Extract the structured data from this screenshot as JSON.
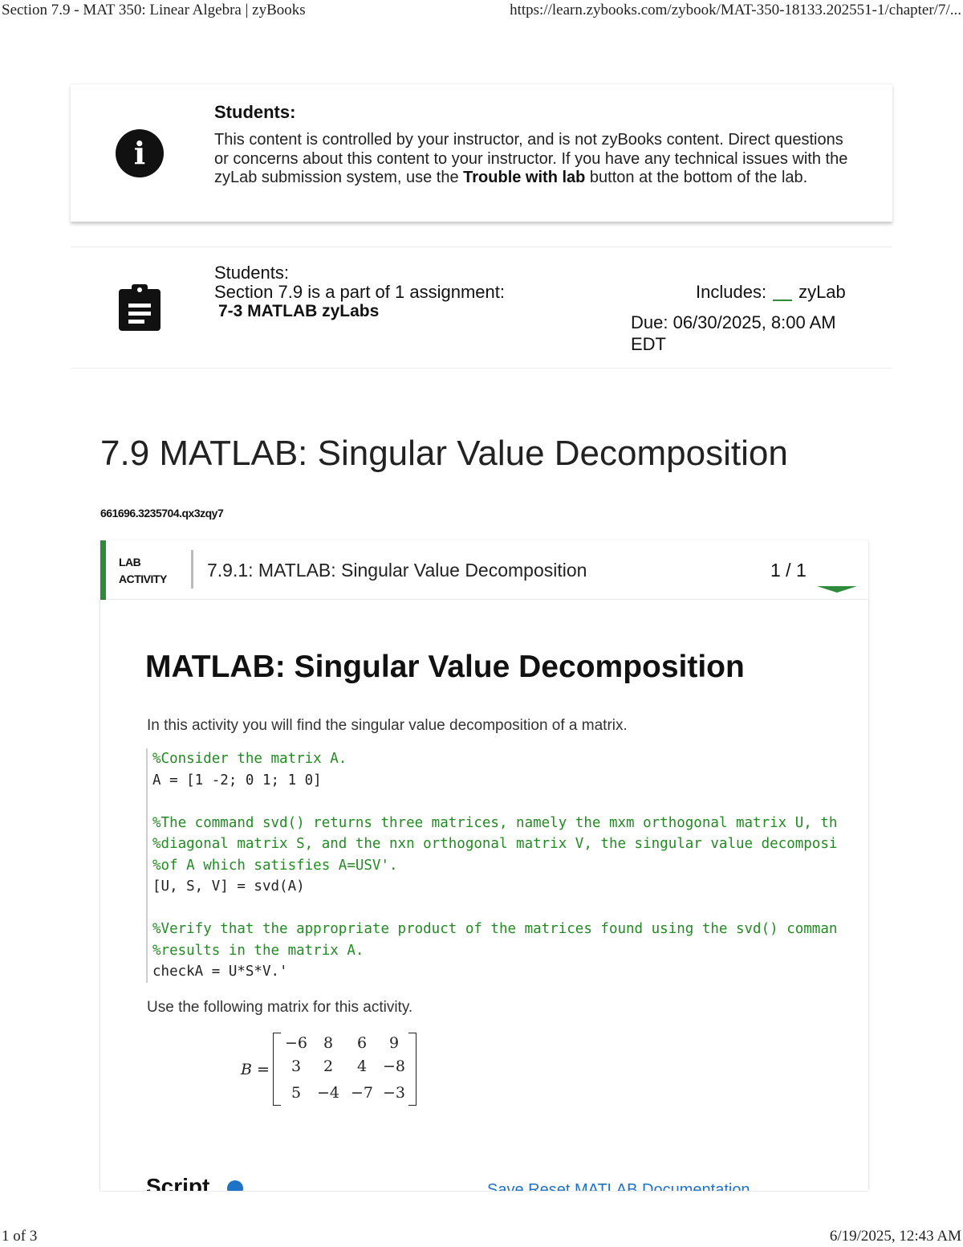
{
  "print_header": {
    "title": "Section 7.9 - MAT 350: Linear Algebra | zyBooks",
    "url": "https://learn.zybooks.com/zybook/MAT-350-18133.202551-1/chapter/7/..."
  },
  "notice": {
    "icon": "info-icon",
    "title": "Students:",
    "body_1": "This content is controlled by your instructor, and is not zyBooks content. Direct questions or concerns about this content to your instructor. If you have any technical issues with the zyLab submission system, use the ",
    "body_bold": "Trouble with lab",
    "body_2": " button at the bottom of the lab."
  },
  "assignment": {
    "icon": "clipboard-icon",
    "label": "Students:",
    "section_text": "Section 7.9 is a part of 1 assignment:",
    "assignment_name": "7-3 MATLAB zyLabs",
    "includes_label": "Includes:",
    "includes_item": "zyLab",
    "due": "Due: 06/30/2025, 8:00 AM EDT"
  },
  "section": {
    "title": "7.9 MATLAB: Singular Value Decomposition",
    "code": "661696.3235704.qx3zqy7"
  },
  "lab_activity": {
    "tag_line_1": "LAB",
    "tag_line_2": "ACTIVITY",
    "title": "7.9.1: MATLAB: Singular Value Decomposition",
    "count": "1 / 1",
    "heading": "MATLAB: Singular Value Decomposition",
    "intro": "In this activity you will find the singular value decomposition of a matrix.",
    "code_lines": [
      "%Consider the matrix A.",
      "A = [1 -2; 0 1; 1 0]",
      "",
      "%The command svd() returns three matrices, namely the mxm orthogonal matrix U, th",
      "%diagonal matrix S, and the nxn orthogonal matrix V, the singular value decomposi",
      "%of A which satisfies A=USV'.",
      "[U, S, V] = svd(A)",
      "",
      "%Verify that the appropriate product of the matrices found using the svd() comman",
      "%results in the matrix A.",
      "checkA = U*S*V.'"
    ],
    "use_text": "Use the following matrix for this activity.",
    "matrix": {
      "name": "B",
      "equals": "=",
      "rows": [
        [
          "−6",
          "8",
          "6",
          "9"
        ],
        [
          "3",
          "2",
          "4",
          "−8"
        ],
        [
          "5",
          "−4",
          "−7",
          "−3"
        ]
      ]
    },
    "script_label": "Script",
    "peek_links": "Save    Reset    MATLAB Documentation"
  },
  "print_footer": {
    "page": "1 of 3",
    "datetime": "6/19/2025, 12:43 AM"
  },
  "colors": {
    "accent_green": "#2e8b3b",
    "comment_green": "#228b22",
    "link_blue": "#1f73c6"
  }
}
